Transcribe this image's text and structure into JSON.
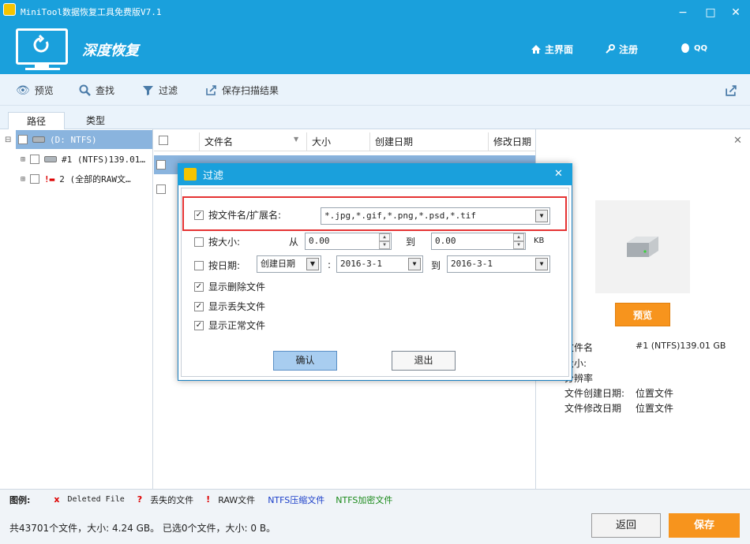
{
  "app": {
    "title": "MiniTool数据恢复工具免费版V7.1",
    "mode_title": "深度恢复",
    "nav": {
      "home": "主界面",
      "register": "注册",
      "qq": "QQ"
    },
    "window_controls": {
      "minimize": "−",
      "maximize": "□",
      "close": "✕"
    }
  },
  "toolbar": {
    "preview": "预览",
    "find": "查找",
    "filter": "过滤",
    "save_scan": "保存扫描结果"
  },
  "tabs": {
    "path": "路径",
    "type": "类型"
  },
  "tree": {
    "root": "(D: NTFS)",
    "item1": "#1  (NTFS)139.01…",
    "item2": "2  (全部的RAW文…"
  },
  "list": {
    "columns": [
      "文件名",
      "大小",
      "创建日期",
      "修改日期"
    ]
  },
  "right_panel": {
    "preview_button": "预览",
    "filename_label": "文件名",
    "filename_value": "#1  (NTFS)139.01 GB",
    "size_label": "大小:",
    "resolution_label": "分辨率",
    "created_label": "文件创建日期:",
    "created_value": "位置文件",
    "modified_label": "文件修改日期",
    "modified_value": "位置文件"
  },
  "legend": {
    "title": "图例:",
    "deleted": "Deleted File",
    "lost": "丢失的文件",
    "raw": "RAW文件",
    "ntfs_compressed": "NTFS压缩文件",
    "ntfs_encrypted": "NTFS加密文件"
  },
  "status": {
    "text": "共43701个文件，大小: 4.24 GB。 已选0个文件，大小: 0 B。",
    "back_button": "返回",
    "save_button": "保存"
  },
  "dialog": {
    "title": "过滤",
    "by_name_label": "按文件名/扩展名:",
    "by_name_value": "*.jpg,*.gif,*.png,*.psd,*.tif",
    "by_size_label": "按大小:",
    "from_label": "从",
    "size_from": "0.00",
    "to_label": "到",
    "size_to": "0.00",
    "size_unit": "KB",
    "by_date_label": "按日期:",
    "date_type": "创建日期",
    "date_sep": ":",
    "date_from": "2016-3-1",
    "date_to_label": "到",
    "date_to": "2016-3-1",
    "show_deleted": "显示删除文件",
    "show_lost": "显示丢失文件",
    "show_normal": "显示正常文件",
    "ok_button": "确认",
    "exit_button": "退出"
  }
}
